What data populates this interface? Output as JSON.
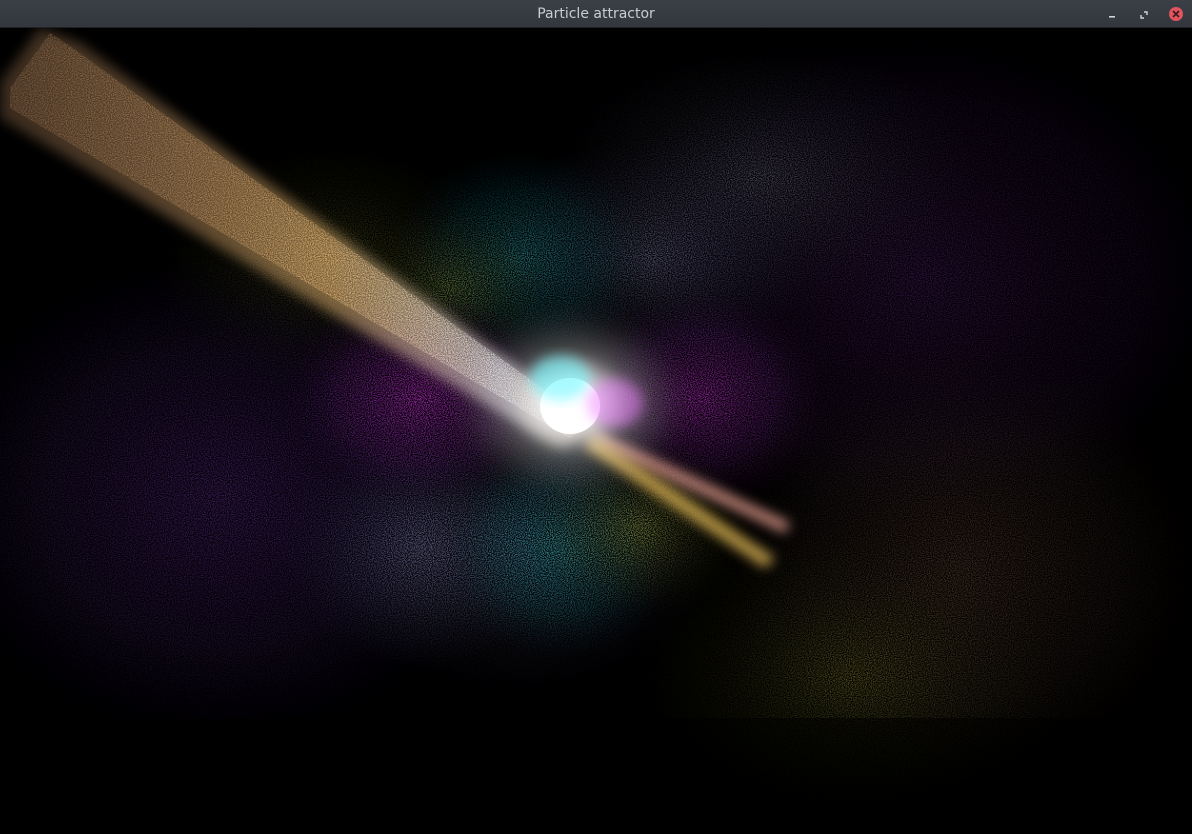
{
  "window": {
    "title": "Particle attractor"
  },
  "titlebar_buttons": {
    "minimize_icon": "minimize-icon",
    "maximize_icon": "maximize-icon",
    "close_icon": "close-icon"
  },
  "colors": {
    "titlebar": "#373b41",
    "title_text": "#c9ccd0",
    "close_button": "#e0545f",
    "background": "#000000",
    "core": "#ffffff",
    "cyan": "#30e8f0",
    "magenta": "#e040f0",
    "gold": "#ffcc70",
    "lavender": "#a8a8ff",
    "yellow_green": "#c8d040"
  }
}
